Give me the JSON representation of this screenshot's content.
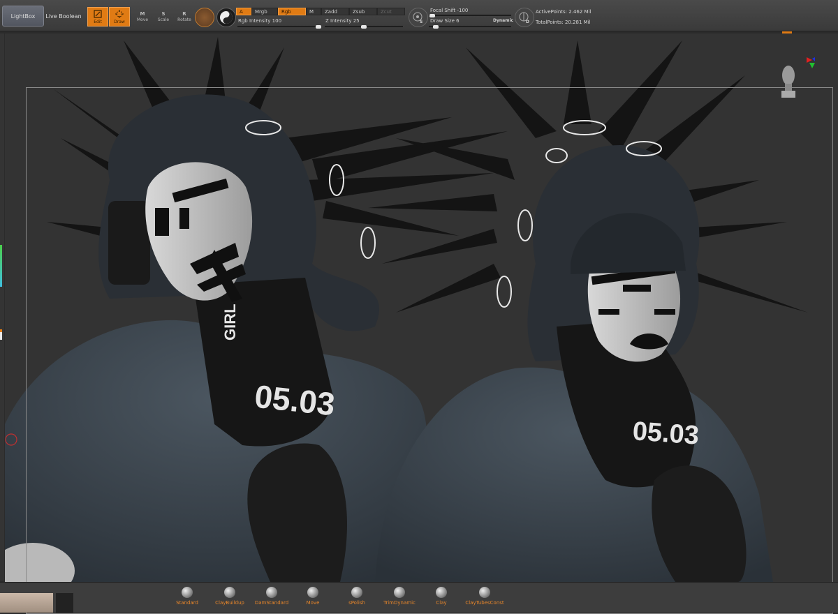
{
  "toolbar": {
    "lightbox": "LightBox",
    "live_boolean": "Live Boolean",
    "edit": "Edit",
    "draw": "Draw",
    "move": "Move",
    "move_key": "M",
    "scale": "Scale",
    "scale_key": "S",
    "rotate": "Rotate",
    "rotate_key": "R",
    "a": "A",
    "mrgb": "Mrgb",
    "rgb": "Rgb",
    "m": "M",
    "zadd": "Zadd",
    "zsub": "Zsub",
    "zcut": "Zcut",
    "rgb_intensity": "Rgb Intensity 100",
    "z_intensity": "Z Intensity 25",
    "focal_shift": "Focal Shift -100",
    "draw_size": "Draw Size 6",
    "dynamic": "Dynamic",
    "s_key": "S",
    "d_key": "D",
    "active_points": "ActivePoints: 2.462 Mil",
    "total_points": "TotalPoints: 20.281 Mil"
  },
  "slider_levels": {
    "rgb_intensity": 100,
    "z_intensity": 25,
    "focal_shift": -100,
    "draw_size": 6
  },
  "brushes": [
    {
      "label": "Standard"
    },
    {
      "label": "ClayBuildup"
    },
    {
      "label": "DamStandard"
    },
    {
      "label": "Move"
    },
    {
      "label": "sPolish"
    },
    {
      "label": "TrimDynamic"
    },
    {
      "label": "Clay"
    },
    {
      "label": "ClayTubesConst"
    }
  ],
  "figures": {
    "left_neck_text": "GIRL",
    "left_chest_text": "05.03",
    "right_chest_text": "05.03"
  },
  "colors": {
    "accent": "#e07b14",
    "brush_label": "#e8862a"
  }
}
